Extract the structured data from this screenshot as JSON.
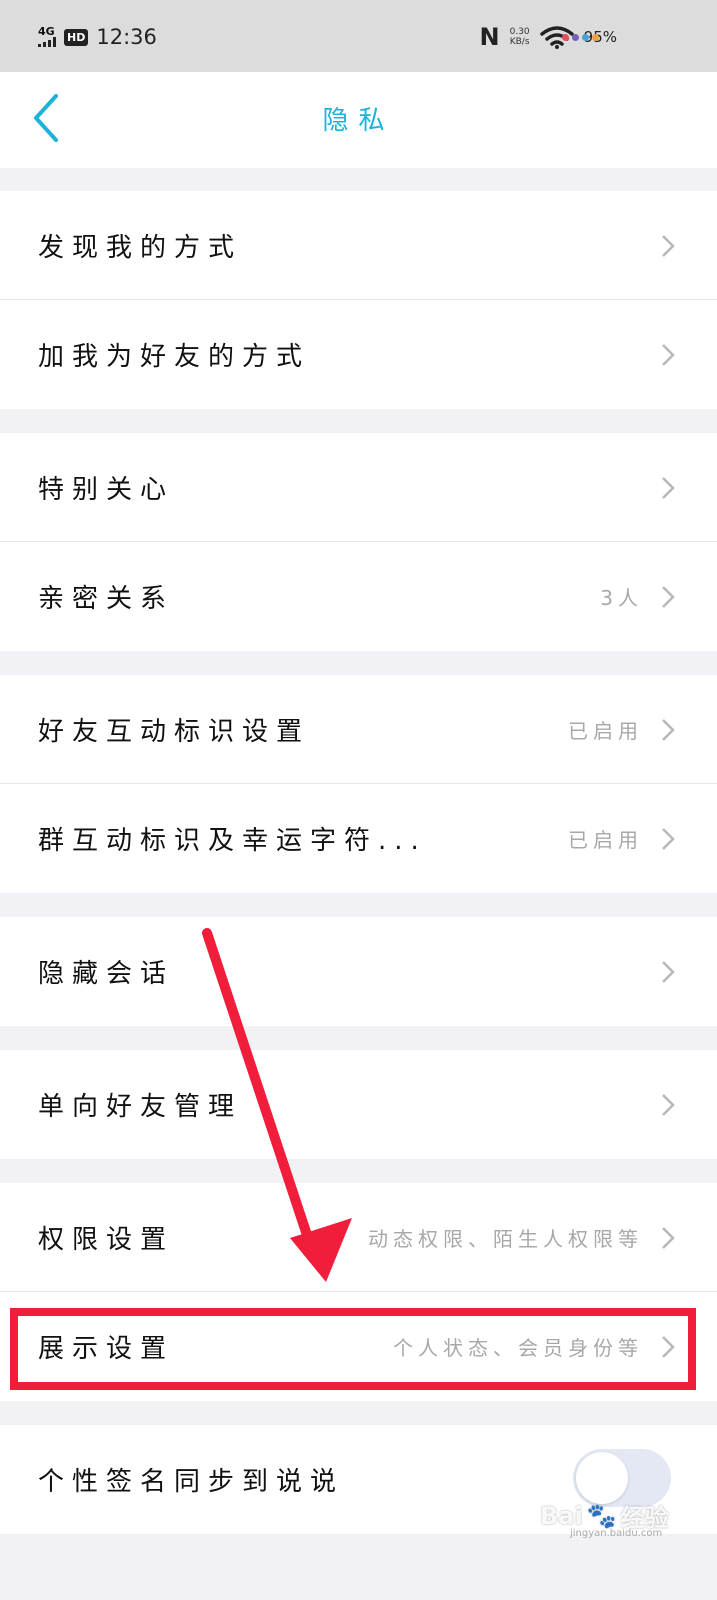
{
  "status_bar": {
    "network": "4G",
    "hd": "HD",
    "time": "12:36",
    "nfc_icon": "nfc-icon",
    "speed_value": "0.30",
    "speed_unit": "KB/s",
    "wifi_icon": "wifi-icon",
    "battery": "95%",
    "dot_colors": [
      "#e84c5d",
      "#7a5fc0",
      "#4aa3d8",
      "#f0a040"
    ]
  },
  "nav": {
    "back_icon": "back-chevron-icon",
    "title": "隐私",
    "accent": "#1db3d8"
  },
  "rows": [
    {
      "label": "发现我的方式",
      "value": ""
    },
    {
      "label": "加我为好友的方式",
      "value": ""
    },
    {
      "label": "特别关心",
      "value": ""
    },
    {
      "label": "亲密关系",
      "value": "3人"
    },
    {
      "label": "好友互动标识设置",
      "value": "已启用"
    },
    {
      "label": "群互动标识及幸运字符...",
      "value": "已启用"
    },
    {
      "label": "隐藏会话",
      "value": ""
    },
    {
      "label": "单向好友管理",
      "value": ""
    },
    {
      "label": "权限设置",
      "value": "动态权限、陌生人权限等"
    },
    {
      "label": "展示设置",
      "value": "个人状态、会员身份等"
    },
    {
      "label": "个性签名同步到说说",
      "toggle_on": false
    }
  ],
  "annotation": {
    "highlight_color": "#f01d3b"
  },
  "watermark": {
    "brand": "Bai",
    "brand2": "经验",
    "url": "jingyan.baidu.com"
  }
}
